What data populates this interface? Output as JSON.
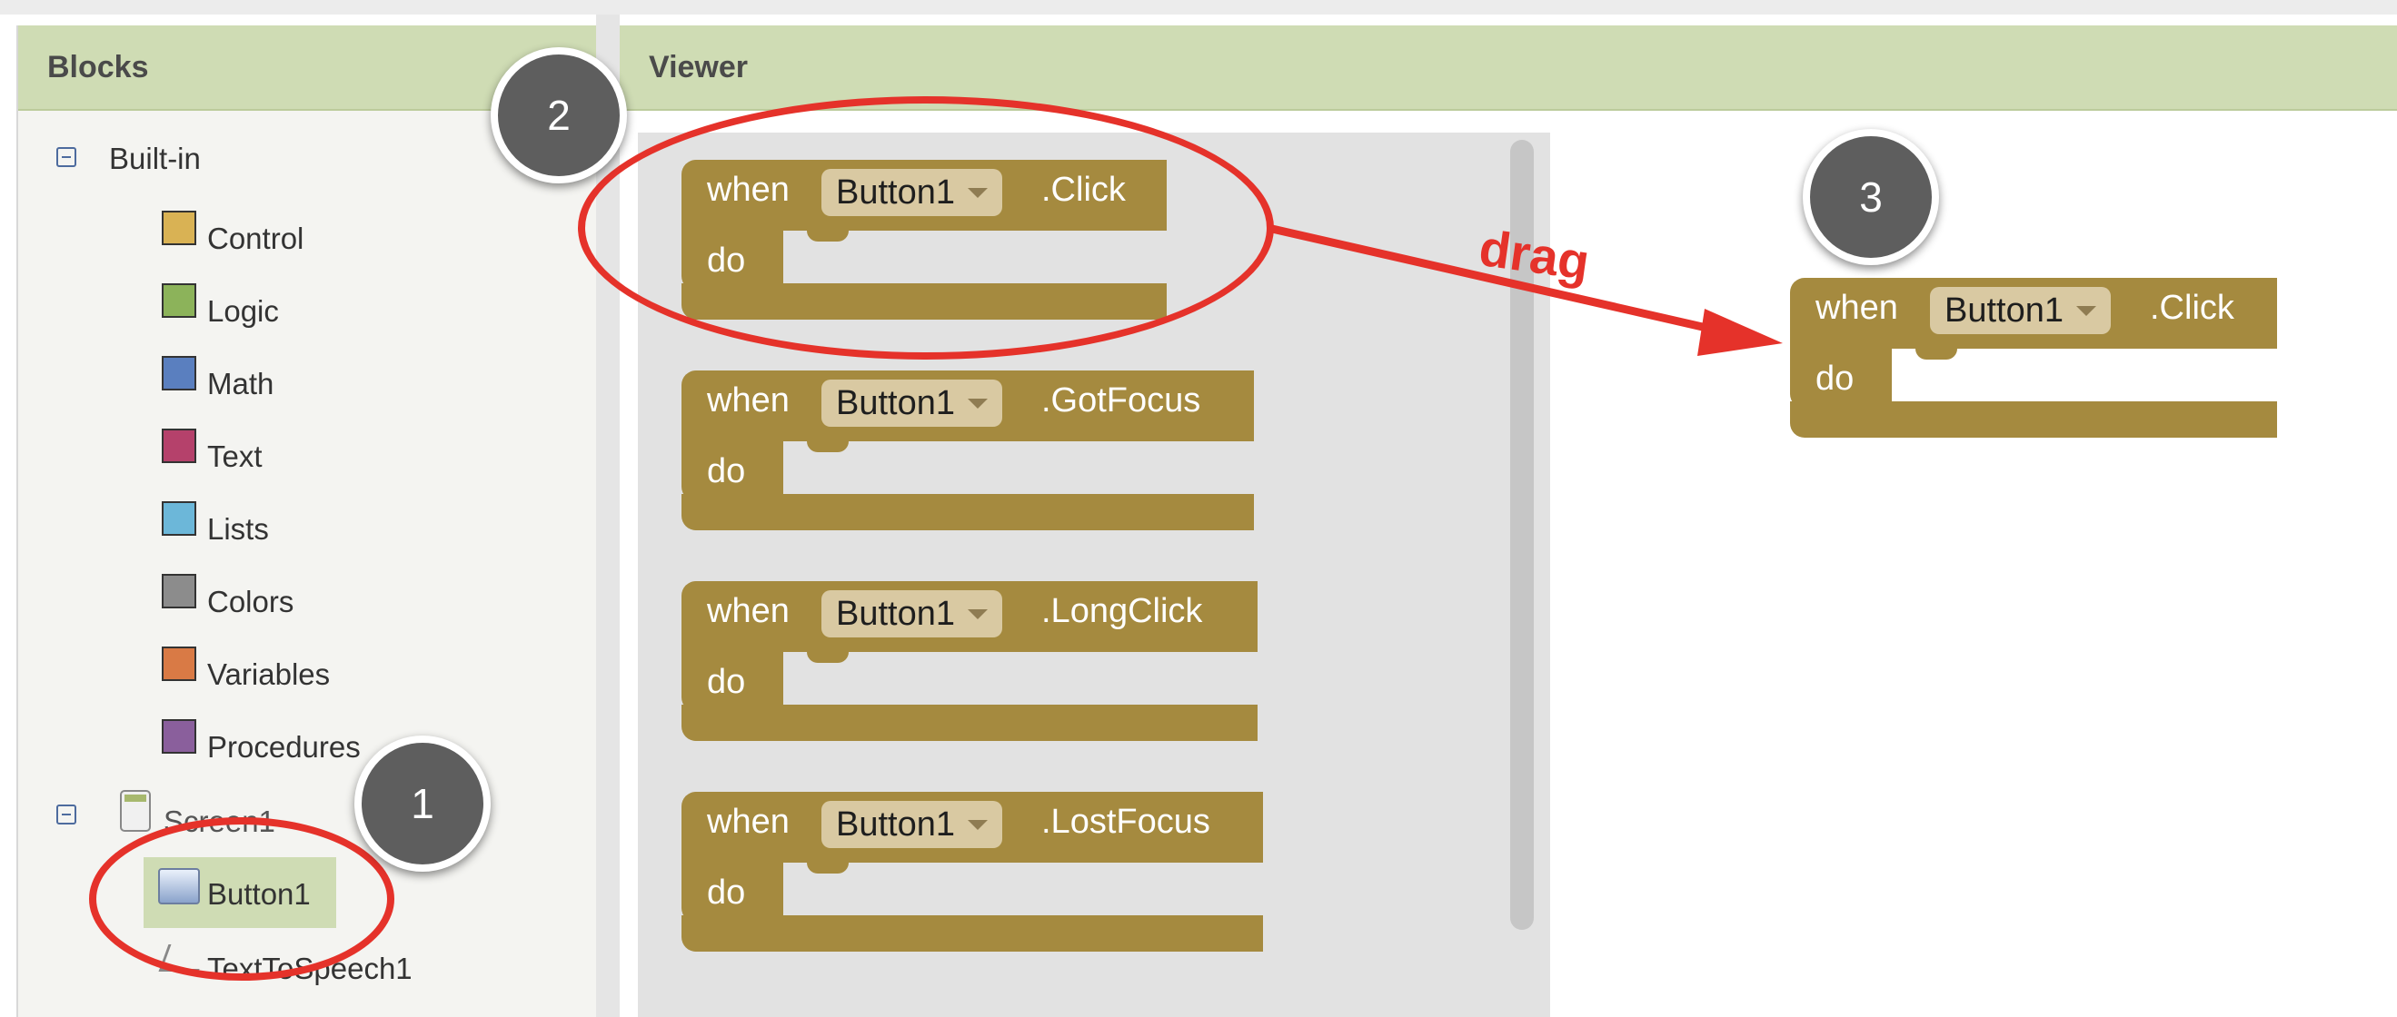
{
  "panels": {
    "blocks_title": "Blocks",
    "viewer_title": "Viewer"
  },
  "tree": {
    "builtin_label": "Built-in",
    "categories": [
      {
        "label": "Control",
        "color": "#d9b254"
      },
      {
        "label": "Logic",
        "color": "#8cb35a"
      },
      {
        "label": "Math",
        "color": "#5a7fbf"
      },
      {
        "label": "Text",
        "color": "#b5416b"
      },
      {
        "label": "Lists",
        "color": "#6cb7d9"
      },
      {
        "label": "Colors",
        "color": "#8c8c8c"
      },
      {
        "label": "Variables",
        "color": "#d97a45"
      },
      {
        "label": "Procedures",
        "color": "#8a5f9c"
      }
    ],
    "screen_label": "Screen1",
    "button_label": "Button1",
    "tts_label": "TextToSpeech1"
  },
  "blocks": {
    "when": "when",
    "do": "do",
    "component": "Button1",
    "events": [
      ".Click",
      ".GotFocus",
      ".LongClick",
      ".LostFocus"
    ],
    "workspace_event": ".Click"
  },
  "annotations": {
    "badge_1": "1",
    "badge_2": "2",
    "badge_3": "3",
    "drag_label": "drag",
    "color": "#e5322a"
  }
}
